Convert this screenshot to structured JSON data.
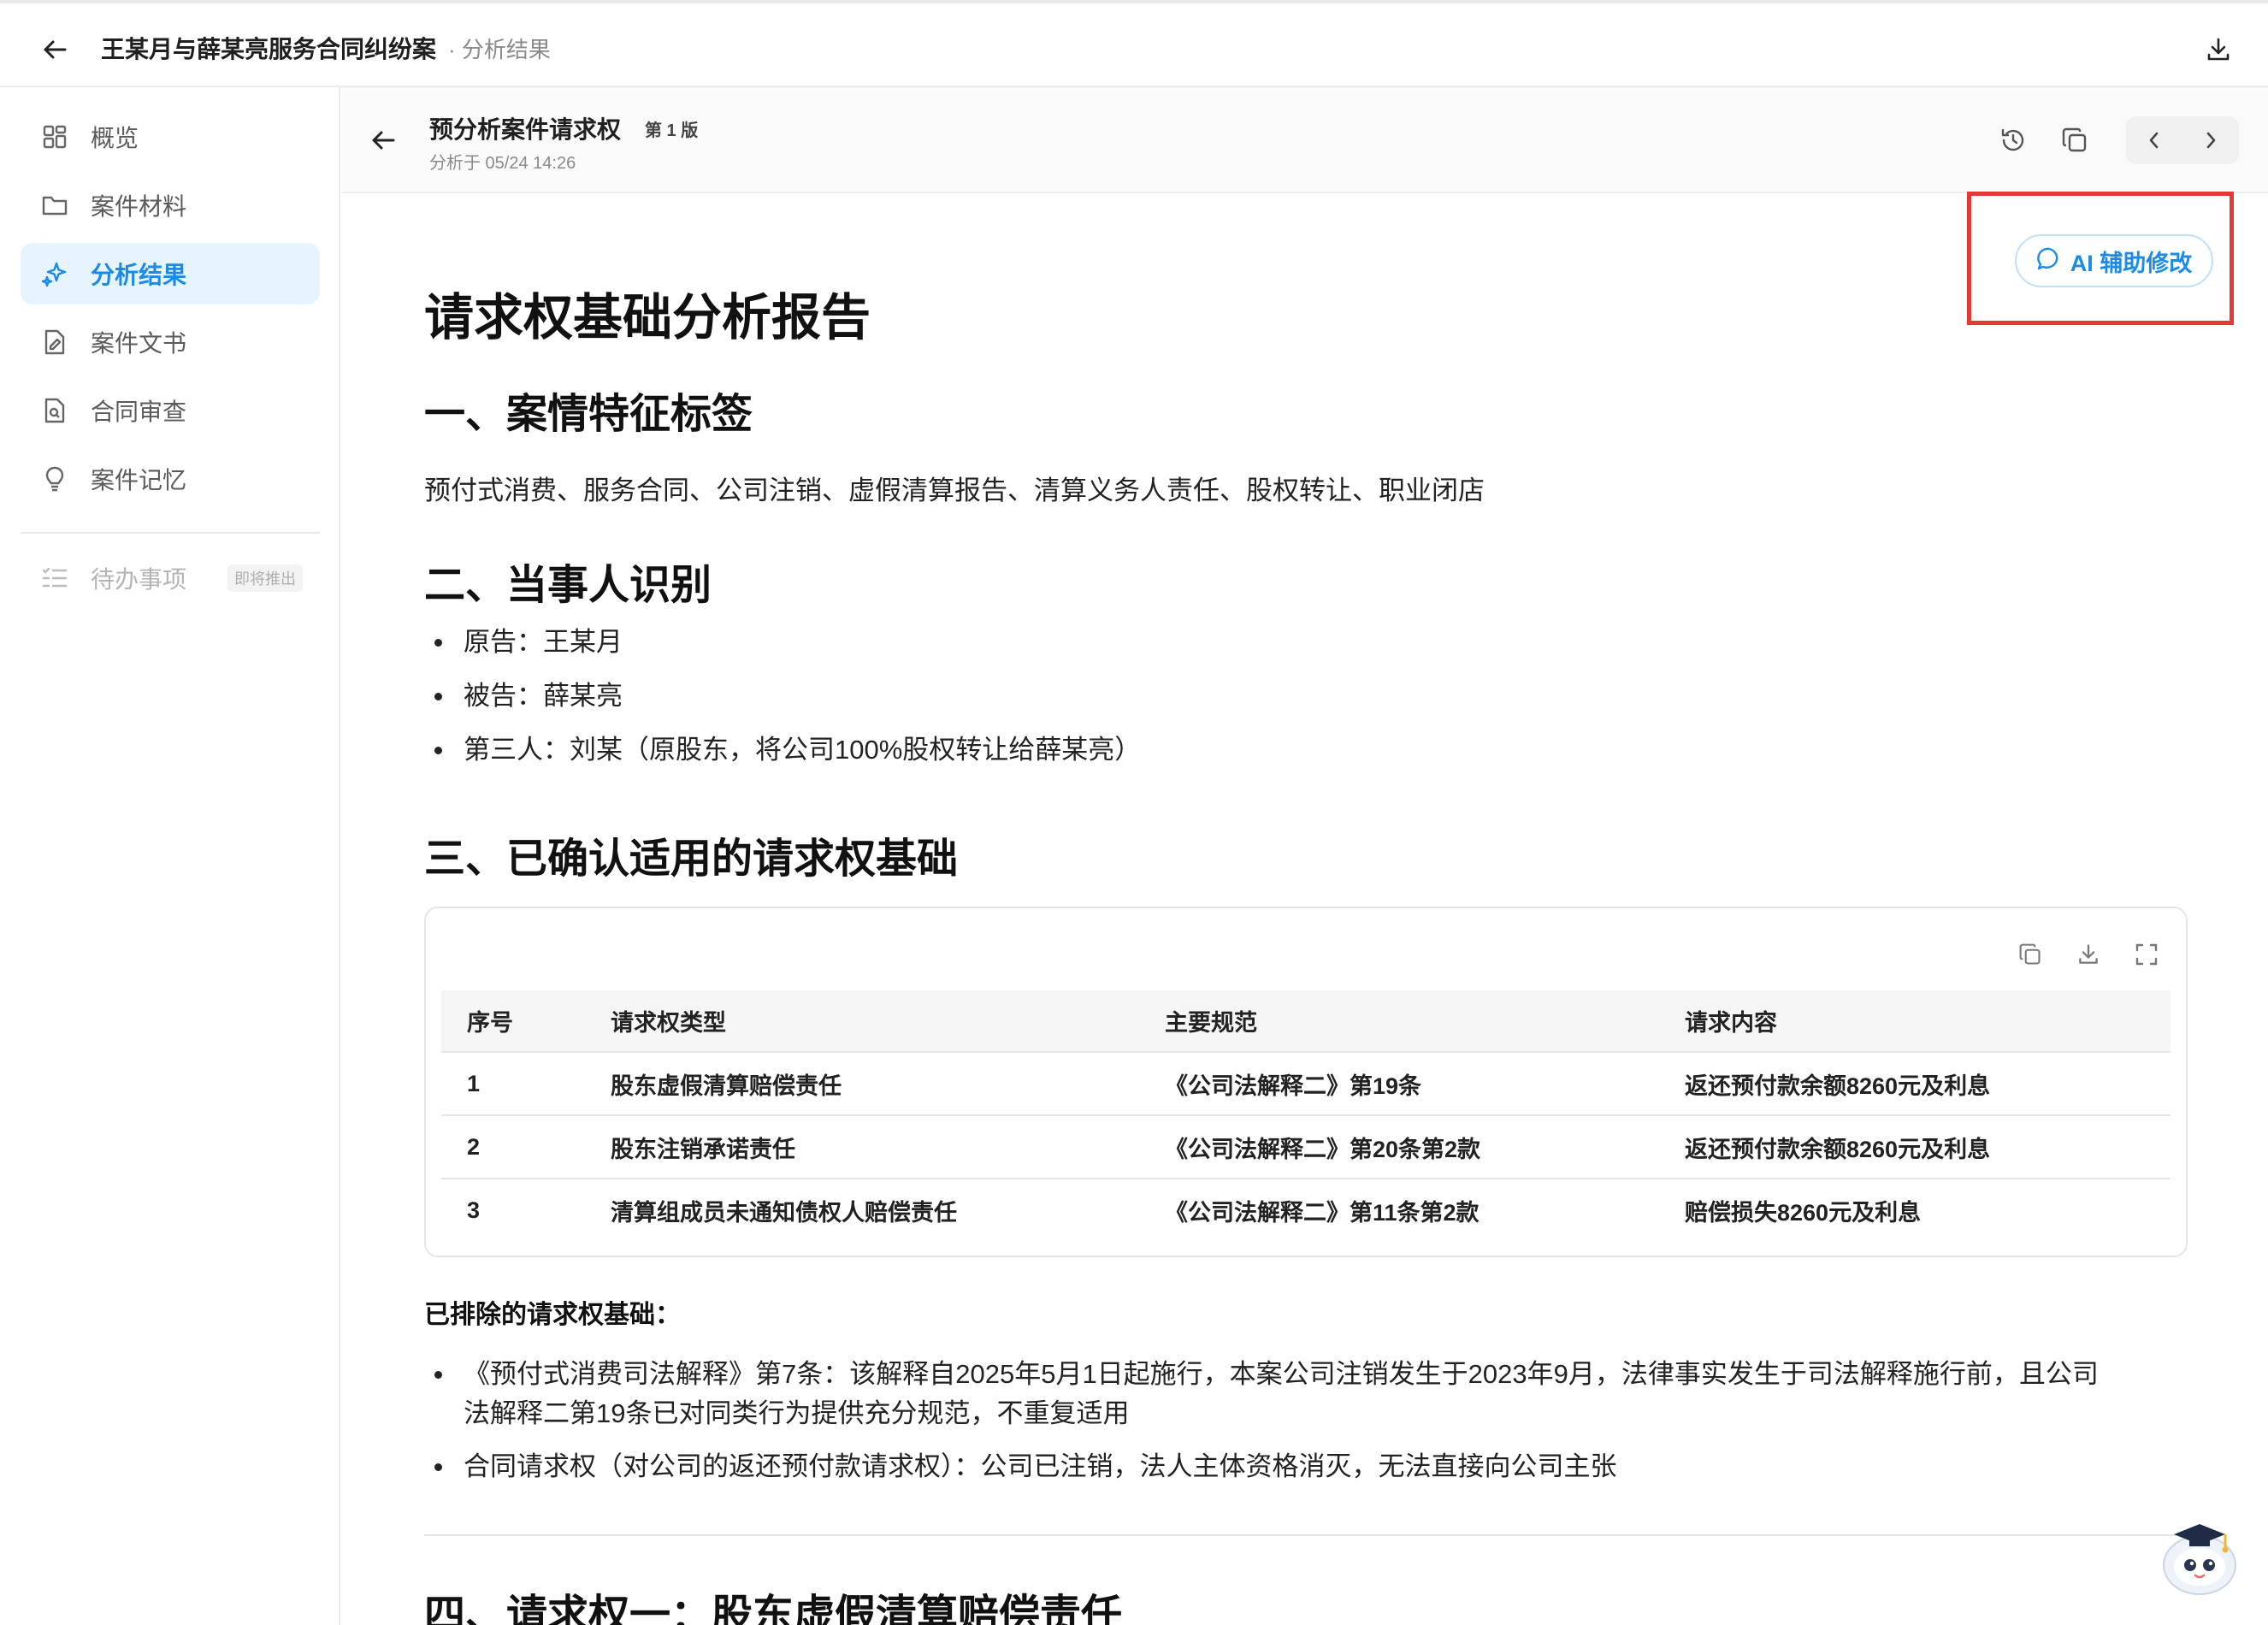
{
  "header": {
    "case_title": "王某月与薛某亮服务合同纠纷案",
    "case_sub": "· 分析结果"
  },
  "sidebar": {
    "items": [
      {
        "label": "概览",
        "icon": "grid-icon"
      },
      {
        "label": "案件材料",
        "icon": "folder-icon"
      },
      {
        "label": "分析结果",
        "icon": "sparkle-icon",
        "active": true
      },
      {
        "label": "案件文书",
        "icon": "document-icon"
      },
      {
        "label": "合同审查",
        "icon": "contract-search-icon"
      },
      {
        "label": "案件记忆",
        "icon": "lightbulb-icon"
      }
    ],
    "todo": {
      "label": "待办事项",
      "badge": "即将推出",
      "icon": "checklist-icon"
    }
  },
  "toolbar": {
    "title": "预分析案件请求权",
    "version": "第 1 版",
    "meta": "分析于 05/24 14:26"
  },
  "ai_button": {
    "label": "AI 辅助修改"
  },
  "doc": {
    "title": "请求权基础分析报告",
    "section1": {
      "heading": "一、案情特征标签",
      "text": "预付式消费、服务合同、公司注销、虚假清算报告、清算义务人责任、股权转让、职业闭店"
    },
    "section2": {
      "heading": "二、当事人识别",
      "items": [
        "原告：王某月",
        "被告：薛某亮",
        "第三人：刘某（原股东，将公司100%股权转让给薛某亮）"
      ]
    },
    "section3": {
      "heading": "三、已确认适用的请求权基础",
      "table": {
        "headers": [
          "序号",
          "请求权类型",
          "主要规范",
          "请求内容"
        ],
        "rows": [
          [
            "1",
            "股东虚假清算赔偿责任",
            "《公司法解释二》第19条",
            "返还预付款余额8260元及利息"
          ],
          [
            "2",
            "股东注销承诺责任",
            "《公司法解释二》第20条第2款",
            "返还预付款余额8260元及利息"
          ],
          [
            "3",
            "清算组成员未通知债权人赔偿责任",
            "《公司法解释二》第11条第2款",
            "赔偿损失8260元及利息"
          ]
        ]
      },
      "excluded_label": "已排除的请求权基础：",
      "excluded": [
        {
          "line1": "《预付式消费司法解释》第7条：该解释自2025年5月1日起施行，本案公司注销发生于2023年9月，法律事实发生于司法解释施行前，且公司",
          "line2": "法解释二第19条已对同类行为提供充分规范，不重复适用"
        },
        {
          "line1": "合同请求权（对公司的返还预付款请求权）：公司已注销，法人主体资格消灭，无法直接向公司主张",
          "line2": ""
        }
      ]
    },
    "section4": {
      "heading": "四、请求权一：股东虚假清算赔偿责任"
    }
  },
  "colors": {
    "accent": "#1a8ce8",
    "highlight": "#e53935"
  }
}
